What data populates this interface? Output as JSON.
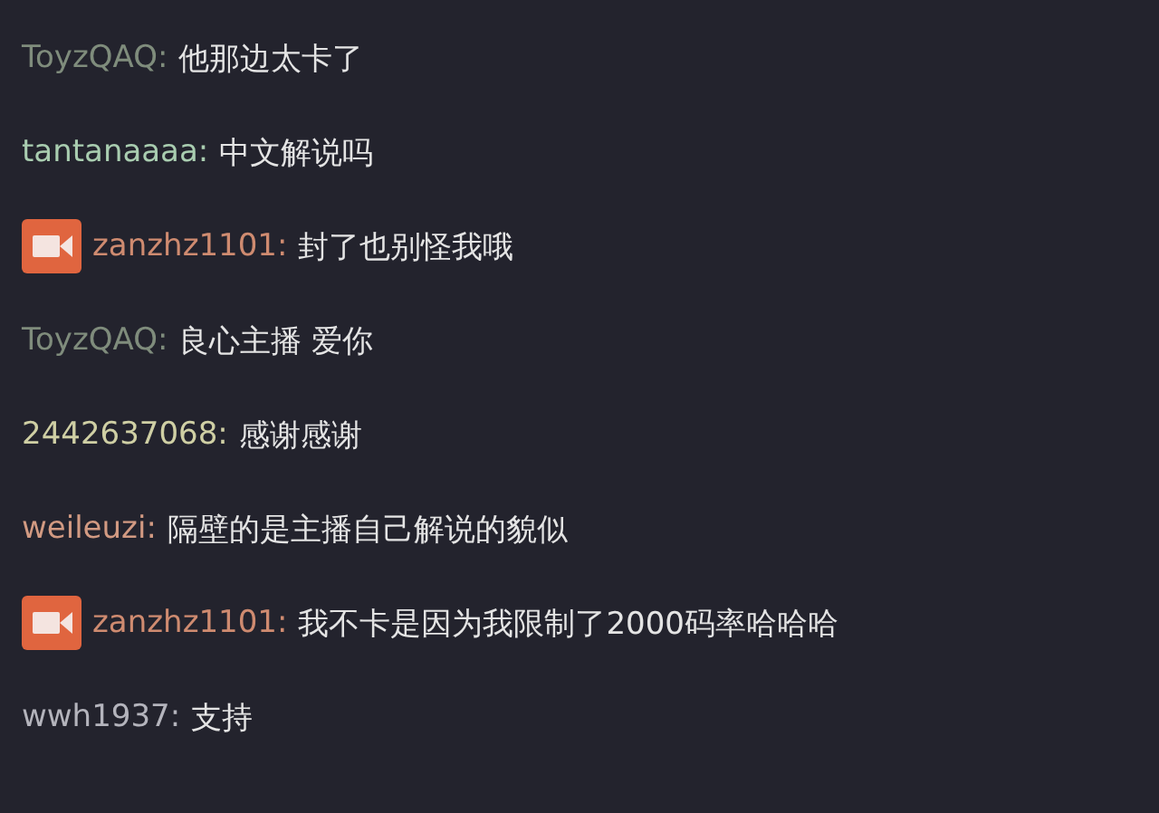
{
  "messages": [
    {
      "user": "ToyzQAQ:",
      "color": "#7f8c7c",
      "host": false,
      "text": "他那边太卡了"
    },
    {
      "user": "tantanaaaa:",
      "color": "#a9cdb0",
      "host": false,
      "text": "中文解说吗"
    },
    {
      "user": "zanzhz1101:",
      "color": "#cf8b70",
      "host": true,
      "text": "封了也别怪我哦"
    },
    {
      "user": "ToyzQAQ:",
      "color": "#7f8c7c",
      "host": false,
      "text": "良心主播 爱你"
    },
    {
      "user": "2442637068:",
      "color": "#cfcfa4",
      "host": false,
      "text": "感谢感谢"
    },
    {
      "user": "weileuzi:",
      "color": "#d29a82",
      "host": false,
      "text": "隔壁的是主播自己解说的貌似"
    },
    {
      "user": "zanzhz1101:",
      "color": "#cf8b70",
      "host": true,
      "text": "我不卡是因为我限制了2000码率哈哈哈"
    },
    {
      "user": "wwh1937:",
      "color": "#b4b4bc",
      "host": false,
      "text": "支持"
    }
  ]
}
